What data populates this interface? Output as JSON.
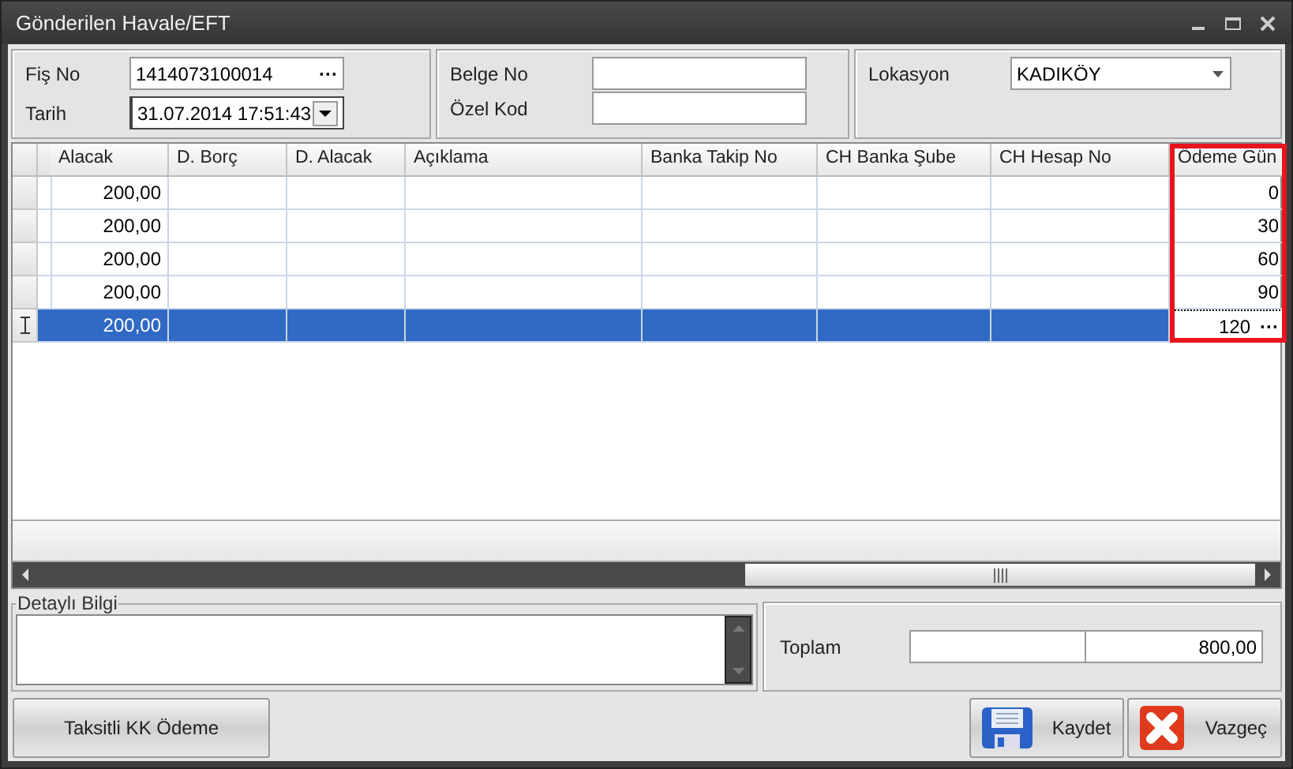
{
  "window": {
    "title": "Gönderilen Havale/EFT"
  },
  "header": {
    "fis_no": {
      "label": "Fiş No",
      "value": "1414073100014",
      "button": "···"
    },
    "tarih": {
      "label": "Tarih",
      "value": "31.07.2014 17:51:43"
    },
    "belge_no": {
      "label": "Belge No"
    },
    "ozel_kod": {
      "label": "Özel Kod"
    },
    "lokasyon": {
      "label": "Lokasyon",
      "value": "KADIKÖY"
    }
  },
  "table": {
    "columns": [
      {
        "label": "Alacak",
        "highlighted": false
      },
      {
        "label": "D.  Borç",
        "highlighted": false
      },
      {
        "label": "D.  Alacak",
        "highlighted": false
      },
      {
        "label": "Açıklama",
        "highlighted": false
      },
      {
        "label": "Banka Takip No",
        "highlighted": false
      },
      {
        "label": "CH Banka Şube",
        "highlighted": false
      },
      {
        "label": "CH Hesap No",
        "highlighted": false
      },
      {
        "label": "Ödeme Gün",
        "highlighted": true
      }
    ],
    "rows": [
      {
        "alacak": "200,00",
        "odeme_gun": "0",
        "selected": false
      },
      {
        "alacak": "200,00",
        "odeme_gun": "30",
        "selected": false
      },
      {
        "alacak": "200,00",
        "odeme_gun": "60",
        "selected": false
      },
      {
        "alacak": "200,00",
        "odeme_gun": "90",
        "selected": false
      },
      {
        "alacak": "200,00",
        "odeme_gun": "120",
        "selected": true
      }
    ],
    "edit_button": "···"
  },
  "detail": {
    "label": "Detaylı Bilgi"
  },
  "total": {
    "label": "Toplam",
    "value": "800,00"
  },
  "buttons": [
    {
      "kind": "plain",
      "label": "Taksitli KK Ödeme"
    },
    {
      "kind": "save",
      "label": "Kaydet"
    },
    {
      "kind": "cancel",
      "label": "Vazgeç"
    }
  ]
}
